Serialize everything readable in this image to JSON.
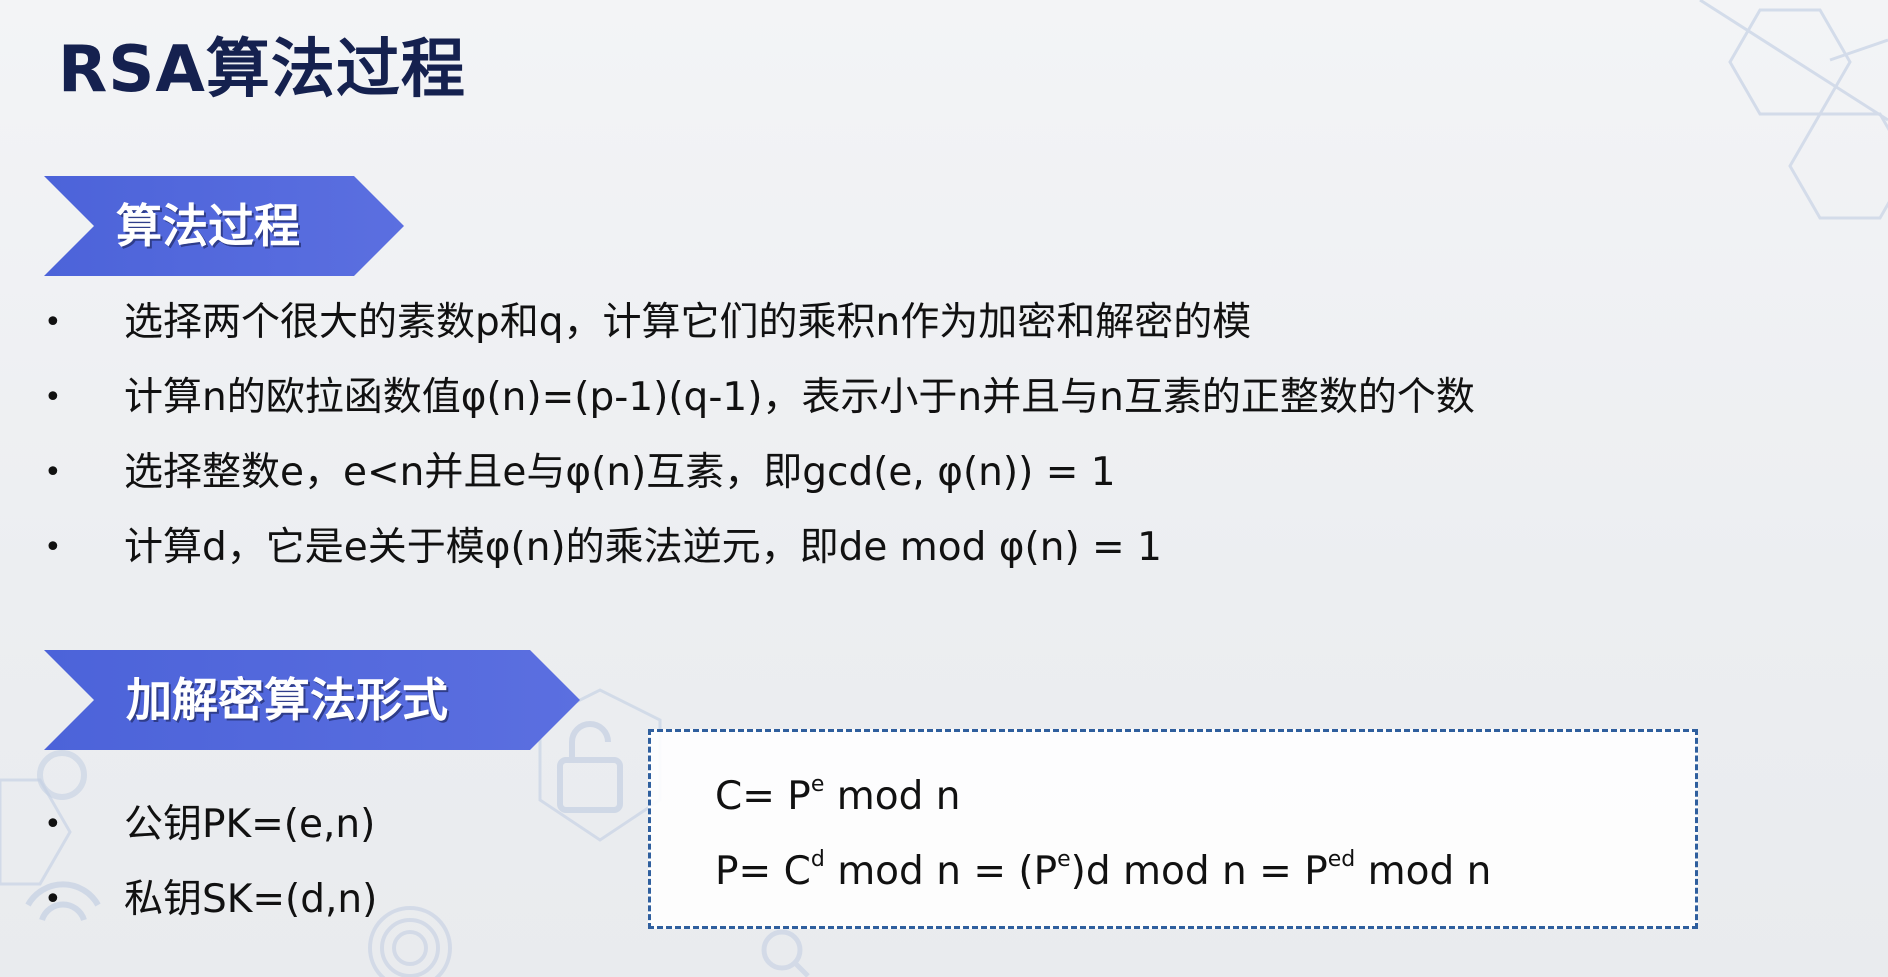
{
  "title": "RSA算法过程",
  "section1": {
    "heading": "算法过程",
    "bullets": [
      "选择两个很大的素数p和q，计算它们的乘积n作为加密和解密的模",
      "计算n的欧拉函数值φ(n)=(p-1)(q-1)，表示小于n并且与n互素的正整数的个数",
      "选择整数e，e<n并且e与φ(n)互素，即gcd(e, φ(n)) = 1",
      "计算d，它是e关于模φ(n)的乘法逆元，即de mod φ(n) = 1"
    ]
  },
  "section2": {
    "heading": "加解密算法形式",
    "keys": [
      "公钥PK=(e,n)",
      "私钥SK=(d,n)"
    ]
  },
  "formulas": {
    "line1": {
      "a": "C= P",
      "sup_e": "e",
      "b": " mod n"
    },
    "line2": {
      "a": "P= C",
      "sup_d": "d",
      "b": " mod n = (P",
      "sup_e": "e",
      "c": ")d mod n = P",
      "sup_ed": "ed",
      "d": " mod n"
    }
  }
}
